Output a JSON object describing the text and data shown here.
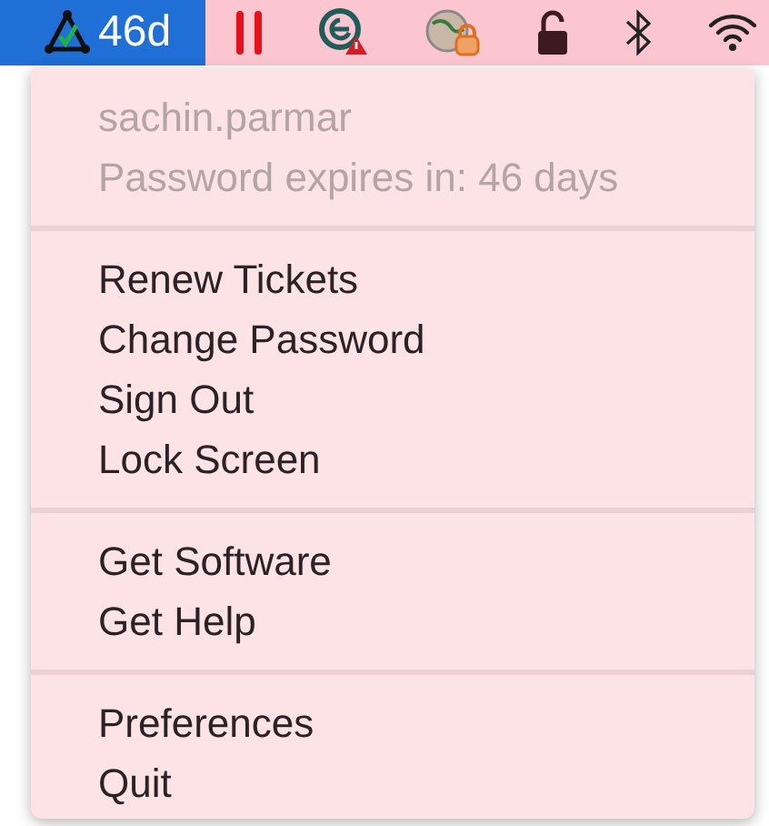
{
  "menu_bar": {
    "app": {
      "label": "46d",
      "selected": true
    },
    "status_icons": [
      {
        "kind": "pause"
      },
      {
        "kind": "badge"
      },
      {
        "kind": "globe"
      },
      {
        "kind": "padlock"
      },
      {
        "kind": "bluetooth"
      },
      {
        "kind": "wifi"
      }
    ]
  },
  "menu": {
    "sections": [
      {
        "items": [
          {
            "label": "sachin.parmar",
            "disabled": true
          },
          {
            "label": "Password expires in: 46 days",
            "disabled": true
          }
        ]
      },
      {
        "items": [
          {
            "label": "Renew Tickets",
            "disabled": false
          },
          {
            "label": "Change Password",
            "disabled": false
          },
          {
            "label": "Sign Out",
            "disabled": false
          },
          {
            "label": "Lock Screen",
            "disabled": false
          }
        ]
      },
      {
        "items": [
          {
            "label": "Get Software",
            "disabled": false
          },
          {
            "label": "Get Help",
            "disabled": false
          }
        ]
      },
      {
        "items": [
          {
            "label": "Preferences",
            "disabled": false
          },
          {
            "label": "Quit",
            "disabled": false
          }
        ]
      }
    ]
  }
}
